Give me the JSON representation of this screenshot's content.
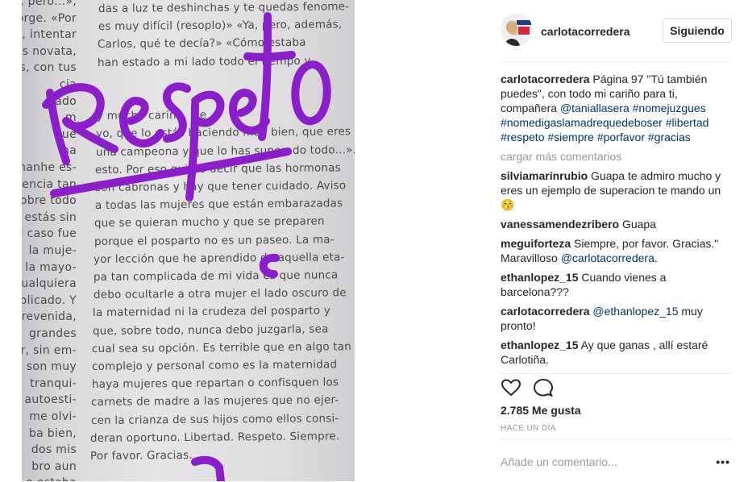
{
  "photo": {
    "left_column_lines": [
      "lleno, pero...»,",
      "Jorge. «Por",
      "fea, intentar",
      "res novata,",
      "das, con tus",
      "cia",
      "ado",
      "m",
      "ue",
      "ha",
      "hanhe es-",
      "idencia tan",
      "obre todo",
      "estás sin",
      "il caso fue",
      "la muje-",
      "la mayo-",
      "cualquiera",
      "plicado. Y",
      "revenida,",
      "grandes",
      "r, sin em-",
      "son muy",
      "tranqui-",
      "autoesti-",
      "me olvi-",
      "ba bien,",
      "dos mis",
      "bro aun",
      "e estaba"
    ],
    "right_column_lines": [
      "das a luz te deshinchas y te quedas fenome-",
      "es muy difícil (resoplo)» «Ya, pero, además,",
      "Carlos, qué te decía?» «Cómo estaba",
      "han estado a mi lado todo el tiempo y",
      "",
      "",
      "y mucho cariño. Me",
      "yo, que lo estás haciendo muy bien, que eres",
      "una campeona y que lo has superado todo...».",
      "esto. Por eso quiero decir que las hormonas",
      "son cabronas y hay que tener cuidado. Aviso",
      "a todas las mujeres que están embarazadas",
      "que se quieran mucho y que se preparen",
      "porque el posparto no es un paseo. La ma-",
      "yor lección que he aprendido de aquella eta-",
      "pa tan complicada de mi vida es que nunca",
      "debo ocultarle a otra mujer el lado oscuro de",
      "la maternidad ni la crudeza del posparto y",
      "que, sobre todo, nunca debo juzgarla, sea",
      "cual sea su opción. Es terrible que en algo tan",
      "complejo y personal como es la maternidad",
      "haya mujeres que repartan o confisquen los",
      "carnets de madre a las mujeres que no ejer-",
      "cen la crianza de sus hijos como ellos consi-",
      "deran oportuno. Libertad. Respeto. Siempre.",
      "Por favor. Gracias."
    ],
    "handwritten_word": "Respeto",
    "ink_color": "#8a1fc9"
  },
  "header": {
    "username": "carlotacorredera",
    "follow_label": "Siguiendo"
  },
  "caption": {
    "user": "carlotacorredera",
    "text_1": " Página 97 \"Tú también puedes\", con todo mi cariño para ti, compañera ",
    "mention": "@taniallasera",
    "tags": "#nomejuzgues #nomedigaslamadrequedeboser #libertad #respeto #siempre #porfavor #gracias"
  },
  "load_more": "cargar más comentarios",
  "comments": [
    {
      "user": "silviamarinrubio",
      "text": " Guapa te admiro mucho y eres un ejemplo de superacion te mando un 😚"
    },
    {
      "user": "vanessamendezribero",
      "text": " Guapa"
    },
    {
      "user": "meguiforteza",
      "text": " Siempre, por favor. Gracias.\" Maravilloso ",
      "mention": "@carlotacorredera",
      "after": "."
    },
    {
      "user": "ethanlopez_15",
      "text": " Cuando vienes a barcelona???"
    },
    {
      "user": "carlotacorredera",
      "text": " ",
      "mention": "@ethanlopez_15",
      "after": " muy pronto!"
    },
    {
      "user": "ethanlopez_15",
      "text": " Ay que ganas , allí estaré Carlotiña."
    }
  ],
  "actions": {
    "like_icon": "heart-icon",
    "comment_icon": "comment-bubble-icon",
    "likes": "2.785 Me gusta",
    "time": "HACE UN DÍA"
  },
  "add_comment": {
    "placeholder": "Añade un comentario...",
    "more_icon": "more-options-icon",
    "more_glyph": "•••"
  }
}
